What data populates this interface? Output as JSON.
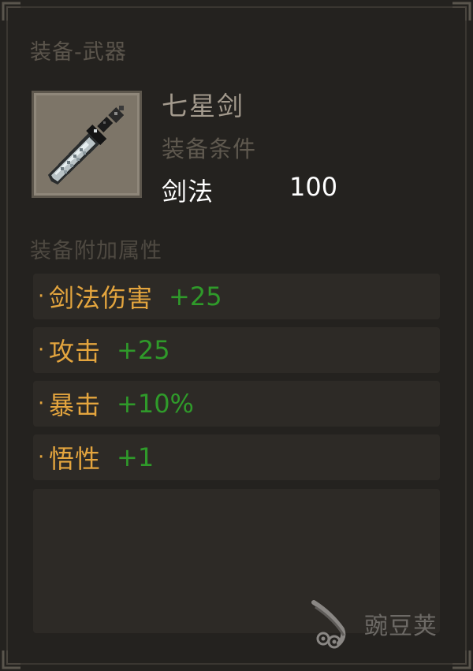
{
  "panel": {
    "category": "装备-武器",
    "item": {
      "name": "七星剑",
      "icon": "sword-icon"
    },
    "requirement": {
      "title": "装备条件",
      "skill": "剑法",
      "value": "100"
    },
    "attributes_title": "装备附加属性",
    "attributes": [
      {
        "name": "剑法伤害",
        "value": "+25"
      },
      {
        "name": "攻击",
        "value": "+25"
      },
      {
        "name": "暴击",
        "value": "+10%"
      },
      {
        "name": "悟性",
        "value": "+1"
      }
    ],
    "bullet": "·"
  },
  "watermark": {
    "text": "豌豆荚"
  },
  "colors": {
    "background": "#24221f",
    "attribute_name": "#e4a53e",
    "attribute_value": "#2f9a2a",
    "requirement_text": "#ffffff"
  }
}
